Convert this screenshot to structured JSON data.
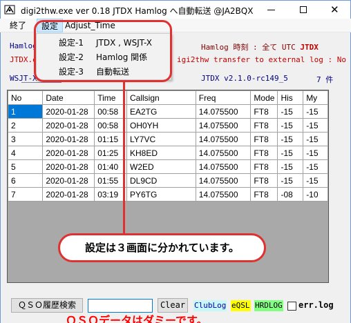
{
  "window": {
    "title": "digi2thw.exe ver 0.18  JTDX  Hamlog へ自動転送  @JA2BQX",
    "minimize_glyph": "—",
    "maximize_glyph": "□",
    "close_glyph": "✕",
    "icon": "app-logo-icon"
  },
  "menu": {
    "exit": "終了",
    "settings": "設定",
    "adjust_time": "Adjust_Time"
  },
  "settings_dropdown": [
    {
      "key": "設定-1",
      "value": "JTDX , WSJT-X"
    },
    {
      "key": "設定-2",
      "value": "Hamlog 関係"
    },
    {
      "key": "設定-3",
      "value": "自動転送"
    }
  ],
  "info": {
    "hamlog_label": "Hamlog",
    "hamlog_time_label": "Hamlog 時刻 : 全て UTC",
    "hamlog_time_app": "JTDX",
    "jtdx_line": "JTDX.e",
    "transfer_line": "igi2thw transfer to external log : No",
    "wsjt_label": "WSJT-X",
    "jtdx_version": "JTDX v2.1.0-rc149_5",
    "record_count": "7 件"
  },
  "table": {
    "headers": [
      "No",
      "Date",
      "Time",
      "Callsign",
      "Freq",
      "Mode",
      "His",
      "My"
    ],
    "rows": [
      [
        "1",
        "2020-01-28",
        "00:58",
        "EA2TG",
        "14.075500",
        "FT8",
        "-15",
        "-15"
      ],
      [
        "2",
        "2020-01-28",
        "00:58",
        "OH0YH",
        "14.075500",
        "FT8",
        "-15",
        "-15"
      ],
      [
        "3",
        "2020-01-28",
        "01:15",
        "LY7VC",
        "14.075500",
        "FT8",
        "-15",
        "-15"
      ],
      [
        "4",
        "2020-01-28",
        "01:25",
        "KH8ED",
        "14.075500",
        "FT8",
        "-15",
        "-15"
      ],
      [
        "5",
        "2020-01-28",
        "01:40",
        "W2ED",
        "14.075500",
        "FT8",
        "-15",
        "-15"
      ],
      [
        "6",
        "2020-01-28",
        "01:55",
        "DL9CD",
        "14.075500",
        "FT8",
        "-15",
        "-15"
      ],
      [
        "7",
        "2020-01-28",
        "03:19",
        "PY6TG",
        "14.075500",
        "FT8",
        "-08",
        "-10"
      ]
    ]
  },
  "annotations": {
    "main_callout": "設定は３画面に分かれています。",
    "dummy_note": "ＱＳＯデータはダミーです。",
    "accent_color": "#e03030"
  },
  "footer": {
    "qso_search_button": "ＱＳＯ履歴検索",
    "search_value": "",
    "clear_button": "Clear",
    "clublog": "ClubLog",
    "eqsl": "eQSL",
    "hrdlog": "HRDLOG",
    "errlog_label": "err.log",
    "errlog_checked": false
  }
}
